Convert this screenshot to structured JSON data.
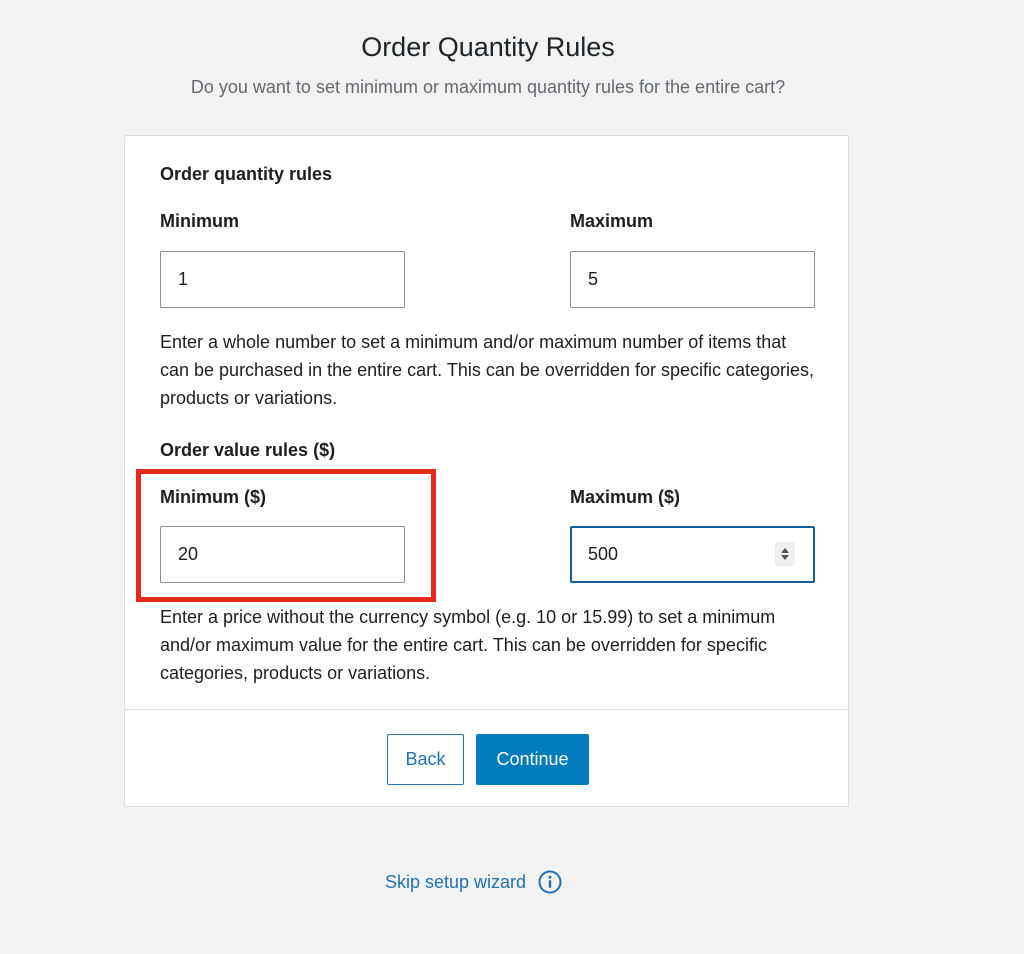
{
  "header": {
    "title": "Order Quantity Rules",
    "subtitle": "Do you want to set minimum or maximum quantity rules for the entire cart?"
  },
  "quantity_rules": {
    "heading": "Order quantity rules",
    "minimum_label": "Minimum",
    "minimum_value": "1",
    "maximum_label": "Maximum",
    "maximum_value": "5",
    "help": "Enter a whole number to set a minimum and/or maximum number of items that can be purchased in the entire cart. This can be overridden for specific categories, products or variations."
  },
  "value_rules": {
    "heading": "Order value rules ($)",
    "minimum_label": "Minimum ($)",
    "minimum_value": "20",
    "maximum_label": "Maximum ($)",
    "maximum_value": "500",
    "help": "Enter a price without the currency symbol (e.g. 10 or 15.99) to set a minimum and/or maximum value for the entire cart. This can be overridden for specific categories, products or variations."
  },
  "actions": {
    "back_label": "Back",
    "continue_label": "Continue"
  },
  "footer": {
    "skip_label": "Skip setup wizard",
    "info_icon": "info-circle-icon"
  },
  "colors": {
    "accent": "#2271b1",
    "primary_button": "#007cba",
    "focus_border": "#135e96",
    "highlight": "#e42a1c",
    "background": "#f1f2f1"
  }
}
